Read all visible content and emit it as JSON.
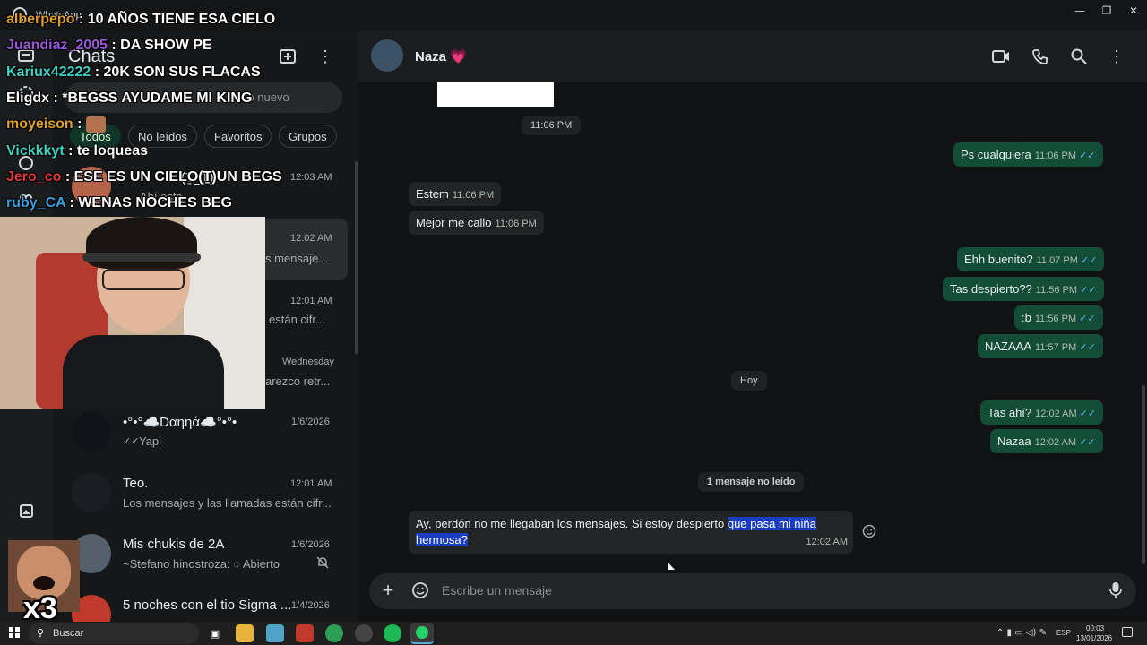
{
  "window": {
    "title": "WhatsApp",
    "minimize_icon": "minimize-icon",
    "restore_icon": "restore-icon",
    "close_icon": "close-icon"
  },
  "sidebar": {
    "title": "Chats",
    "new_chat_icon": "new-chat-icon",
    "menu_icon": "more-vert-icon"
  },
  "search": {
    "placeholder_visible": "uno nuevo"
  },
  "filters": [
    {
      "label": "Todos",
      "active": true
    },
    {
      "label": "No leídos"
    },
    {
      "label": "Favoritos"
    },
    {
      "label": "Grupos"
    }
  ],
  "chat_list": [
    {
      "name": "(Ṯ_Ṯ)",
      "time": "12:03 AM",
      "preview": "Ahí esta"
    },
    {
      "name": "",
      "time": "12:02 AM",
      "preview": "s mensaje..."
    },
    {
      "name": "",
      "time": "12:01 AM",
      "preview": "están cifr..."
    },
    {
      "name": "",
      "time": "Wednesday",
      "preview": "arezco retr..."
    },
    {
      "name": "•°•°☁️Dαηηά☁️°•°•",
      "time": "1/6/2026",
      "preview": "Yapi"
    },
    {
      "name": "Teo.",
      "time": "12:01 AM",
      "preview": "Los mensajes y las llamadas están cifr..."
    },
    {
      "name": "Mis chukis de 2A",
      "time": "1/6/2026",
      "preview": "~Stefano hinostroza: ◌ Abierto"
    },
    {
      "name": "5 noches con el tio Sigma ...",
      "time": "1/4/2026",
      "preview": ""
    }
  ],
  "conversation": {
    "contact_name": "Naza 💗",
    "header_icons": [
      "video-call-icon",
      "phone-icon",
      "search-icon",
      "more-vert-icon"
    ],
    "day_label": "Hoy",
    "unread_label": "1 mensaje no leído",
    "image_time": "11:06 PM",
    "messages": [
      {
        "dir": "out",
        "text": "Ps cualquiera",
        "time": "11:06 PM"
      },
      {
        "dir": "in",
        "text": "Estem",
        "time": "11:06 PM"
      },
      {
        "dir": "in",
        "text": "Mejor me callo",
        "time": "11:06 PM"
      },
      {
        "dir": "out",
        "text": "Ehh buenito?",
        "time": "11:07 PM"
      },
      {
        "dir": "out",
        "text": "Tas despierto??",
        "time": "11:56 PM"
      },
      {
        "dir": "out",
        "text": ":b",
        "time": "11:56 PM"
      },
      {
        "dir": "out",
        "text": "NAZAAA",
        "time": "11:57 PM"
      },
      {
        "dir": "out",
        "text": "Tas ahí?",
        "time": "12:02 AM"
      },
      {
        "dir": "out",
        "text": "Nazaa",
        "time": "12:02 AM"
      }
    ],
    "last_message": {
      "text_plain": "Ay, perdón no me llegaban los mensajes. Si estoy despierto ",
      "text_selected_1": "que pasa mi niña ",
      "text_selected_2": "hermosa?",
      "time": "12:02 AM"
    },
    "composer_placeholder": "Escribe un mensaje",
    "check_glyph": "✓✓"
  },
  "stream_chat": [
    {
      "user": "alberpepo",
      "color": "#e0a02c",
      "message": " : 10 AÑOS TIENE ESA CIELO"
    },
    {
      "user": "Juandiaz_2005",
      "color": "#9b59d8",
      "message": " : DA SHOW PE"
    },
    {
      "user": "Kariux42222",
      "color": "#3fd1c4",
      "message": " : 20K SON SUS FLACAS"
    },
    {
      "user": "Eligdx",
      "color": "#ffffff",
      "message": " : *BEGSS AYUDAME MI KING"
    },
    {
      "user": "moyeison",
      "color": "#e0a02c",
      "message": " : "
    },
    {
      "user": "Vickkkyt",
      "color": "#3fd1c4",
      "message": " : te loqueas"
    },
    {
      "user": "Jero_co",
      "color": "#e23b3b",
      "message": " : ESE ES UN CIELO(Ṯ)UN BEGS"
    },
    {
      "user": "ruby_CA",
      "color": "#3aa0e0",
      "message": " : WENAS NOCHES BEG"
    }
  ],
  "meme_overlay": {
    "text": "x3"
  },
  "taskbar": {
    "search_label": "Buscar",
    "lang": "ESP",
    "clock_time": "00:03",
    "clock_date": "13/01/2026"
  },
  "colors": {
    "accent": "#144d37",
    "ticks": "#53bdeb",
    "selection": "#1b3dc2"
  }
}
